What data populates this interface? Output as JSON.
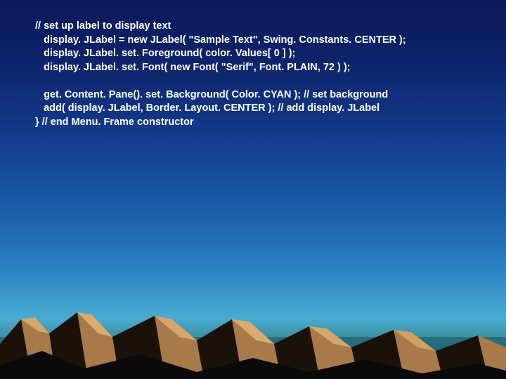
{
  "code": {
    "line1": "// set up label to display text",
    "line2": "   display. JLabel = new JLabel( \"Sample Text\", Swing. Constants. CENTER );",
    "line3": "   display. JLabel. set. Foreground( color. Values[ 0 ] );",
    "line4": "   display. JLabel. set. Font( new Font( \"Serif\", Font. PLAIN, 72 ) );",
    "line5": "",
    "line6": "   get. Content. Pane(). set. Background( Color. CYAN ); // set background",
    "line7": "   add( display. JLabel, Border. Layout. CENTER ); // add display. JLabel",
    "line8": "} // end Menu. Frame constructor"
  },
  "theme": {
    "sky_top": "#0a1a5a",
    "sky_bottom": "#2a6a78",
    "mountain_dark": "#0d1a2a",
    "mountain_light": "#c8955a",
    "text_color": "#ffffff"
  }
}
